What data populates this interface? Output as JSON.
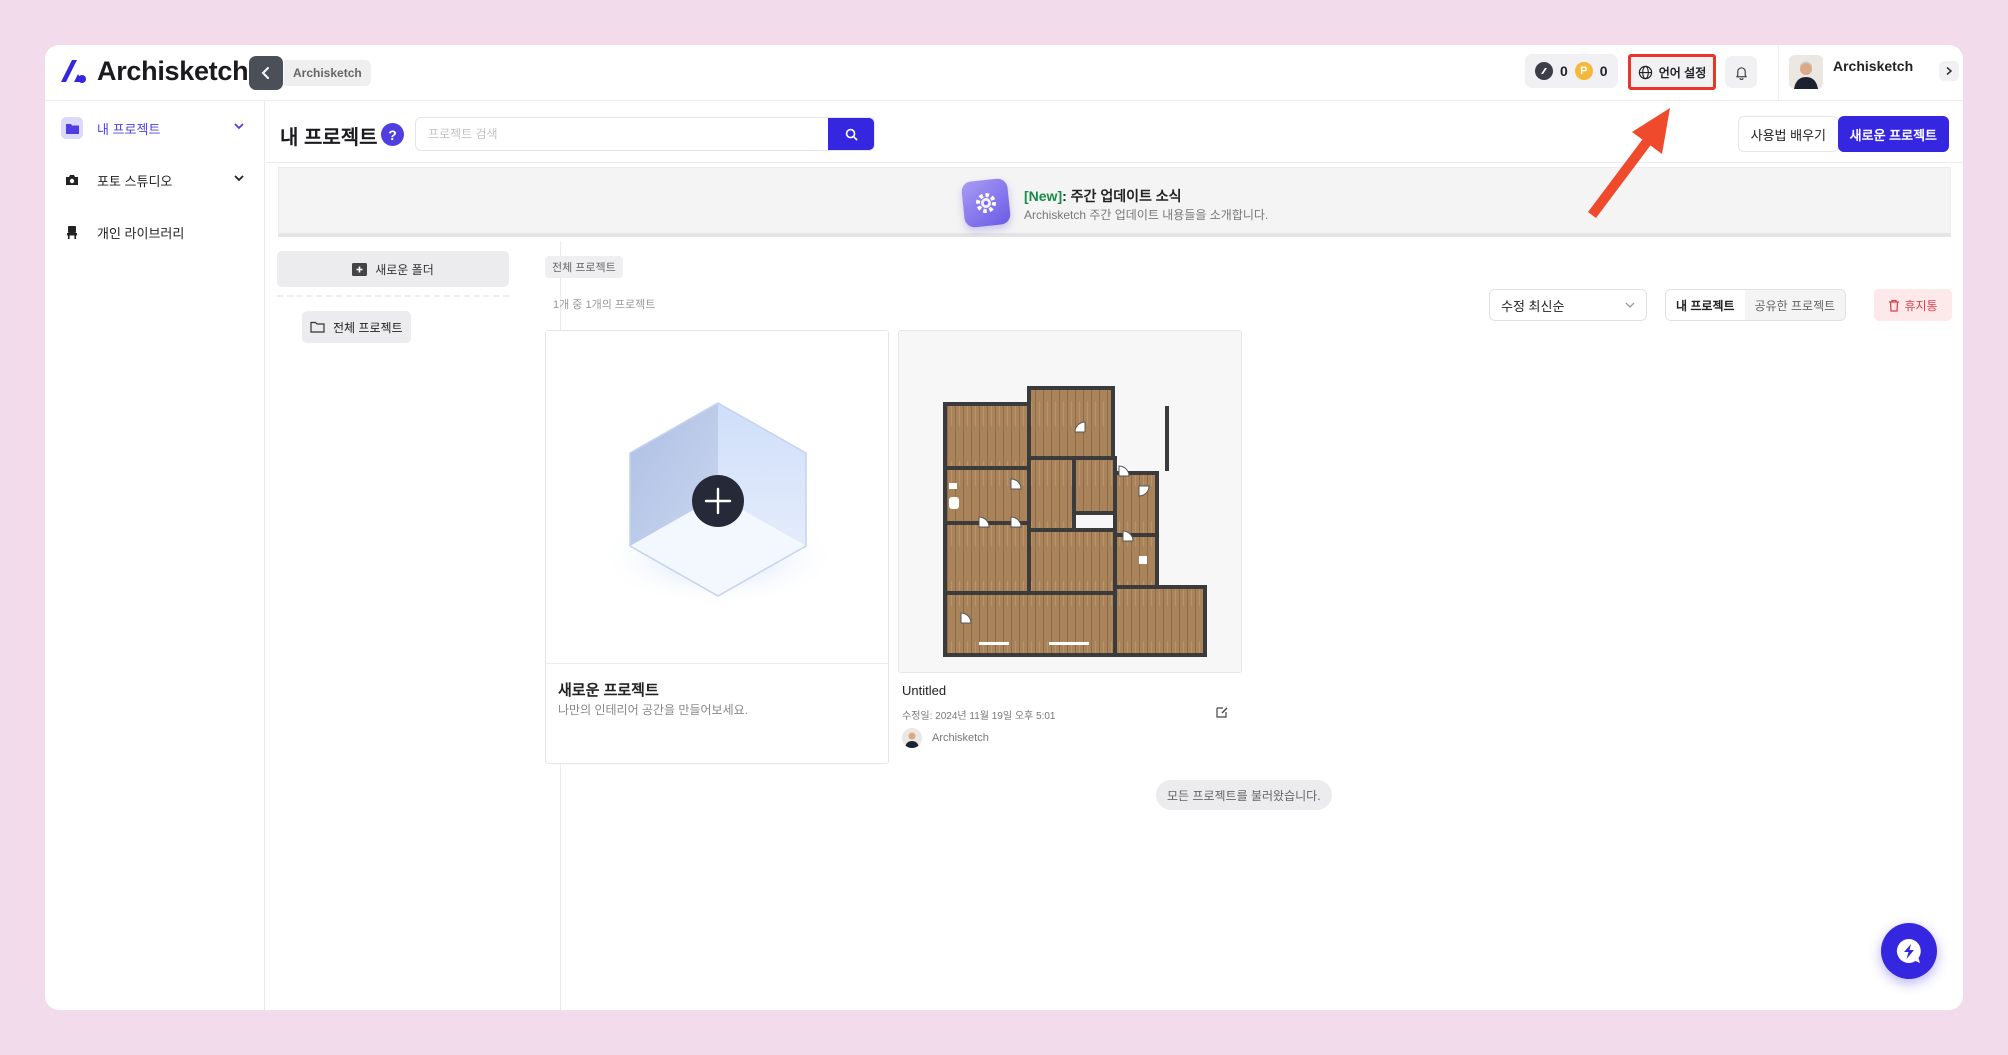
{
  "app": {
    "logo_text": "Archisketch",
    "breadcrumb": "Archisketch"
  },
  "topbar": {
    "credit_a": "0",
    "credit_p_symbol": "P",
    "credit_p": "0",
    "language_label": "언어 설정",
    "user_name": "Archisketch"
  },
  "sidebar": {
    "items": [
      {
        "label": "내 프로젝트",
        "icon": "folder-icon",
        "active": true
      },
      {
        "label": "포토 스튜디오",
        "icon": "camera-icon",
        "active": false
      },
      {
        "label": "개인 라이브러리",
        "icon": "chair-icon",
        "active": false
      }
    ]
  },
  "header": {
    "title": "내 프로젝트",
    "help": "?",
    "search_placeholder": "프로젝트 검색",
    "howto_label": "사용법 배우기",
    "new_project_label": "새로운 프로젝트"
  },
  "banner": {
    "tag": "[New]",
    "title_rest": ": 주간 업데이트 소식",
    "subtitle": "Archisketch 주간 업데이트 내용들을 소개합니다."
  },
  "folders": {
    "new_folder_label": "새로운 폴더",
    "all_projects_label": "전체 프로젝트"
  },
  "content": {
    "breadcrumb": "전체 프로젝트",
    "count_text": "1개 중 1개의 프로젝트",
    "sort_value": "수정 최신순",
    "seg_mine": "내 프로젝트",
    "seg_shared": "공유한 프로젝트",
    "trash_label": "휴지통",
    "new_card_title": "새로운 프로젝트",
    "new_card_sub": "나만의 인테리어 공간을 만들어보세요.",
    "project_title": "Untitled",
    "project_date": "수정일: 2024년 11월 19일 오후 5:01",
    "project_owner": "Archisketch",
    "loaded_text": "모든 프로젝트를 불러왔습니다."
  },
  "colors": {
    "accent": "#3526e0",
    "highlight": "#e8362a",
    "background": "#f2dbea"
  }
}
